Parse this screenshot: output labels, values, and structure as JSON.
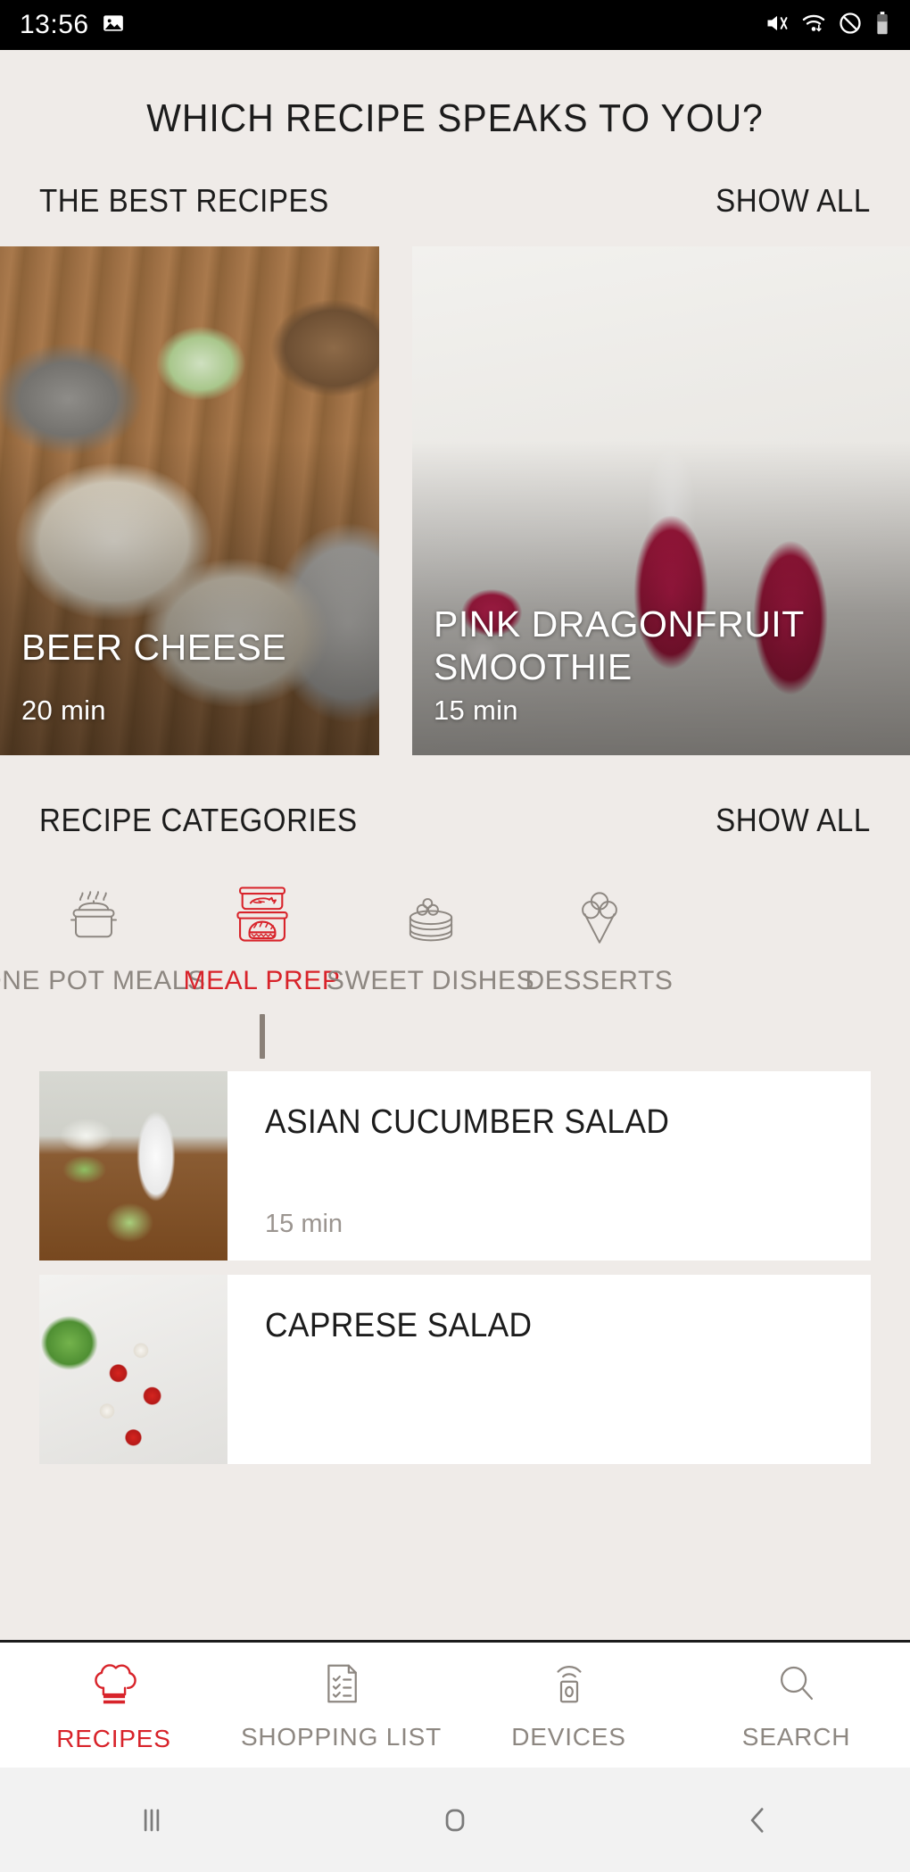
{
  "statusbar": {
    "time": "13:56",
    "left_icons": [
      "image-icon"
    ],
    "right_icons": [
      "mute-icon",
      "wifi-icon",
      "do-not-disturb-icon",
      "battery-icon"
    ]
  },
  "app": {
    "title": "WHICH RECIPE SPEAKS TO YOU?",
    "accent_color": "#d8232a",
    "background_color": "#efebe8"
  },
  "featured_section": {
    "title": "THE BEST RECIPES",
    "show_all": "SHOW ALL",
    "cards": [
      {
        "title": "BEER CHEESE",
        "time": "20 min",
        "photo": "beer-cheese-photo"
      },
      {
        "title": "PINK DRAGONFRUIT SMOOTHIE",
        "time": "15 min",
        "photo": "pink-dragonfruit-smoothie-photo"
      }
    ]
  },
  "categories_section": {
    "title": "RECIPE CATEGORIES",
    "show_all": "SHOW ALL",
    "items": [
      {
        "label": "ONE POT MEALS",
        "icon": "pot-with-steam-icon",
        "active": false
      },
      {
        "label": "MEAL PREP",
        "icon": "stacked-food-containers-icon",
        "active": true
      },
      {
        "label": "SWEET DISHES",
        "icon": "pancake-stack-icon",
        "active": false
      },
      {
        "label": "DESSERTS",
        "icon": "ice-cream-cone-icon",
        "active": false
      }
    ]
  },
  "recipe_list": [
    {
      "title": "ASIAN CUCUMBER SALAD",
      "time": "15 min",
      "photo": "asian-cucumber-salad-photo"
    },
    {
      "title": "CAPRESE SALAD",
      "time": "",
      "photo": "caprese-salad-photo"
    }
  ],
  "tabbar": [
    {
      "label": "RECIPES",
      "icon": "chef-hat-icon",
      "active": true
    },
    {
      "label": "SHOPPING LIST",
      "icon": "checklist-icon",
      "active": false
    },
    {
      "label": "DEVICES",
      "icon": "device-signal-icon",
      "active": false
    },
    {
      "label": "SEARCH",
      "icon": "magnifier-icon",
      "active": false
    }
  ],
  "android_nav": [
    {
      "icon": "recents-icon"
    },
    {
      "icon": "home-icon"
    },
    {
      "icon": "back-icon"
    }
  ]
}
